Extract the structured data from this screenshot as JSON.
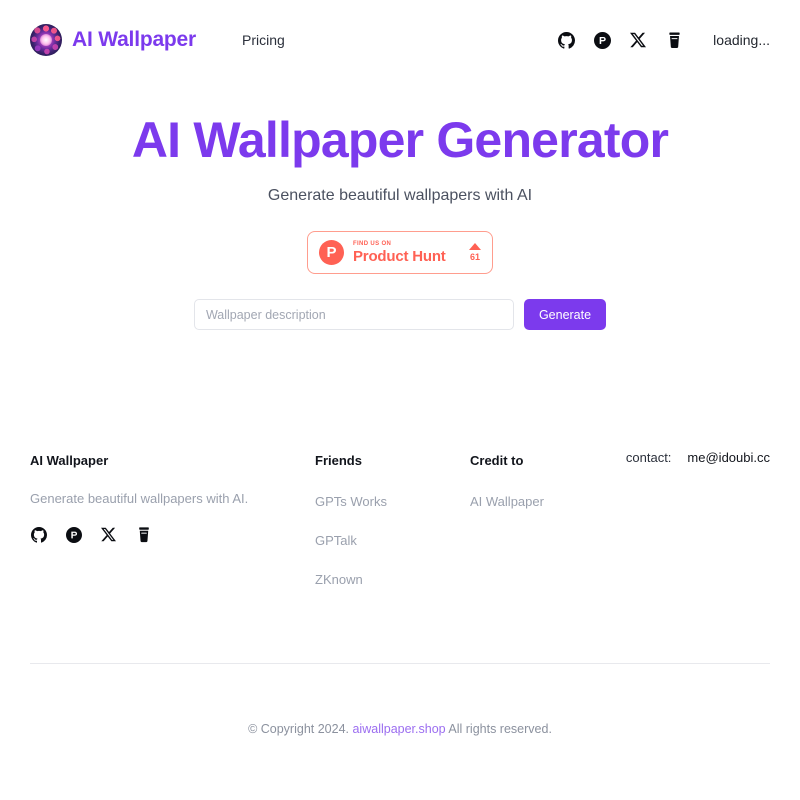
{
  "header": {
    "brand_name": "AI Wallpaper",
    "logo_icon": "mandala-logo-icon",
    "nav": [
      {
        "label": "Pricing",
        "name": "nav-pricing"
      }
    ],
    "socials": [
      {
        "icon": "github-icon",
        "name": "header-social-github"
      },
      {
        "icon": "product-hunt-icon",
        "name": "header-social-product-hunt"
      },
      {
        "icon": "x-twitter-icon",
        "name": "header-social-x"
      },
      {
        "icon": "buy-me-a-coffee-icon",
        "name": "header-social-buymeacoffee"
      }
    ],
    "status_text": "loading..."
  },
  "hero": {
    "title": "AI Wallpaper Generator",
    "subtitle": "Generate beautiful wallpapers with AI",
    "badge": {
      "eyebrow": "FIND US ON",
      "name": "Product Hunt",
      "logo_letter": "P",
      "vote_count": "61"
    },
    "form": {
      "input_value": "",
      "input_placeholder": "Wallpaper description",
      "submit_label": "Generate"
    }
  },
  "footer": {
    "brand": {
      "title": "AI Wallpaper",
      "description": "Generate beautiful wallpapers with AI.",
      "socials": [
        {
          "icon": "github-icon",
          "name": "footer-social-github"
        },
        {
          "icon": "product-hunt-icon",
          "name": "footer-social-product-hunt"
        },
        {
          "icon": "x-twitter-icon",
          "name": "footer-social-x"
        },
        {
          "icon": "buy-me-a-coffee-icon",
          "name": "footer-social-buymeacoffee"
        }
      ]
    },
    "friends": {
      "title": "Friends",
      "links": [
        {
          "label": "GPTs Works"
        },
        {
          "label": "GPTalk"
        },
        {
          "label": "ZKnown"
        }
      ]
    },
    "credit": {
      "title": "Credit to",
      "links": [
        {
          "label": "AI Wallpaper"
        }
      ]
    },
    "contact": {
      "label": "contact:",
      "value": "me@idoubi.cc"
    }
  },
  "copyright": {
    "prefix": "© Copyright 2024.",
    "link": "aiwallpaper.shop",
    "suffix": "All rights reserved."
  },
  "colors": {
    "brand_purple": "#7c3aed",
    "product_hunt_red": "#ff6154",
    "muted_text": "#9aa0ad",
    "link_purple": "#9b6df0"
  }
}
